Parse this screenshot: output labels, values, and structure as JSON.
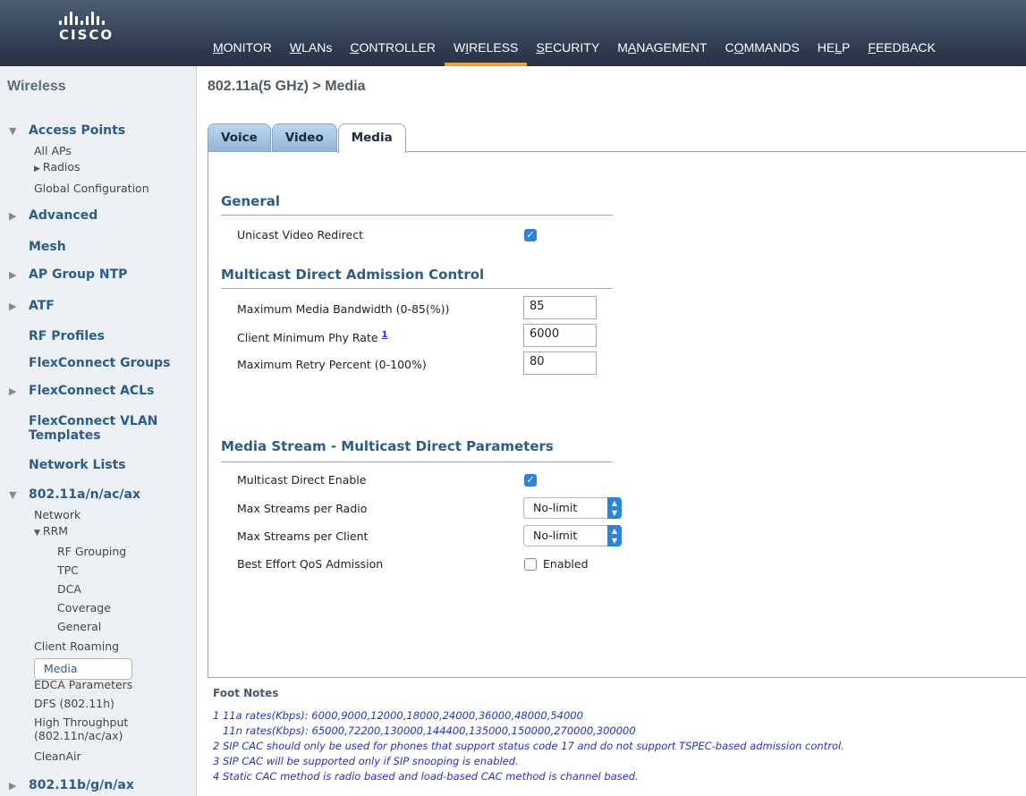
{
  "brand": {
    "logo_text": "CISCO"
  },
  "nav": [
    {
      "label": "MONITOR",
      "u": "M",
      "rest": "ONITOR"
    },
    {
      "label": "WLANs",
      "u": "W",
      "rest": "LANs"
    },
    {
      "label": "CONTROLLER",
      "u": "C",
      "rest": "ONTROLLER"
    },
    {
      "label": "WIRELESS",
      "pre": "W",
      "u": "I",
      "rest": "RELESS"
    },
    {
      "label": "SECURITY",
      "u": "S",
      "rest": "ECURITY"
    },
    {
      "label": "MANAGEMENT",
      "pre": "M",
      "u": "A",
      "rest": "NAGEMENT"
    },
    {
      "label": "COMMANDS",
      "pre": "C",
      "u": "O",
      "rest": "MMANDS"
    },
    {
      "label": "HELP",
      "pre": "HE",
      "u": "L",
      "rest": "P"
    },
    {
      "label": "FEEDBACK",
      "u": "F",
      "rest": "EEDBACK"
    }
  ],
  "sidebar": {
    "title": "Wireless",
    "access_points": {
      "label": "Access Points",
      "items": [
        "All APs",
        "Radios",
        "Global Configuration"
      ]
    },
    "advanced": "Advanced",
    "mesh": "Mesh",
    "ap_group_ntp": "AP Group NTP",
    "atf": "ATF",
    "rf_profiles": "RF Profiles",
    "flex_groups": "FlexConnect Groups",
    "flex_acls": "FlexConnect ACLs",
    "flex_vlan_1": "FlexConnect VLAN",
    "flex_vlan_2": "Templates",
    "network_lists": "Network Lists",
    "band_a": {
      "label": "802.11a/n/ac/ax",
      "network": "Network",
      "rrm": "RRM",
      "rrm_items": [
        "RF Grouping",
        "TPC",
        "DCA",
        "Coverage",
        "General"
      ],
      "items": [
        "Client Roaming",
        "Media",
        "EDCA Parameters",
        "DFS (802.11h)",
        "High Throughput",
        "(802.11n/ac/ax)",
        "CleanAir"
      ]
    },
    "band_b": "802.11b/g/n/ax"
  },
  "page": {
    "title": "802.11a(5 GHz) > Media"
  },
  "tabs": [
    "Voice",
    "Video",
    "Media"
  ],
  "general": {
    "heading": "General",
    "unicast_label": "Unicast Video Redirect",
    "unicast_checked": true
  },
  "mdac": {
    "heading": "Multicast Direct Admission Control",
    "max_bw_label": "Maximum Media Bandwidth (0-85(%))",
    "max_bw_value": "85",
    "min_phy_label": "Client Minimum Phy Rate",
    "min_phy_footnote": "1",
    "min_phy_value": "6000",
    "retry_label": "Maximum Retry Percent (0-100%)",
    "retry_value": "80"
  },
  "msmdp": {
    "heading": "Media Stream - Multicast Direct Parameters",
    "md_enable_label": "Multicast Direct Enable",
    "md_enable_checked": true,
    "streams_radio_label": "Max Streams per Radio",
    "streams_radio_value": "No-limit",
    "streams_client_label": "Max Streams per Client",
    "streams_client_value": "No-limit",
    "best_effort_label": "Best Effort QoS Admission",
    "best_effort_checked": false,
    "enabled_label": "Enabled"
  },
  "footnotes": {
    "title": "Foot Notes",
    "lines": [
      "1 11a rates(Kbps): 6000,9000,12000,18000,24000,36000,48000,54000",
      "   11n rates(Kbps): 65000,72200,130000,144400,135000,150000,270000,300000",
      "2 SIP CAC should only be used for phones that support status code 17 and do not support TSPEC-based admission control.",
      "3 SIP CAC will be supported only if SIP snooping is enabled.",
      "4 Static CAC method is radio based and load-based CAC method is channel based."
    ]
  }
}
